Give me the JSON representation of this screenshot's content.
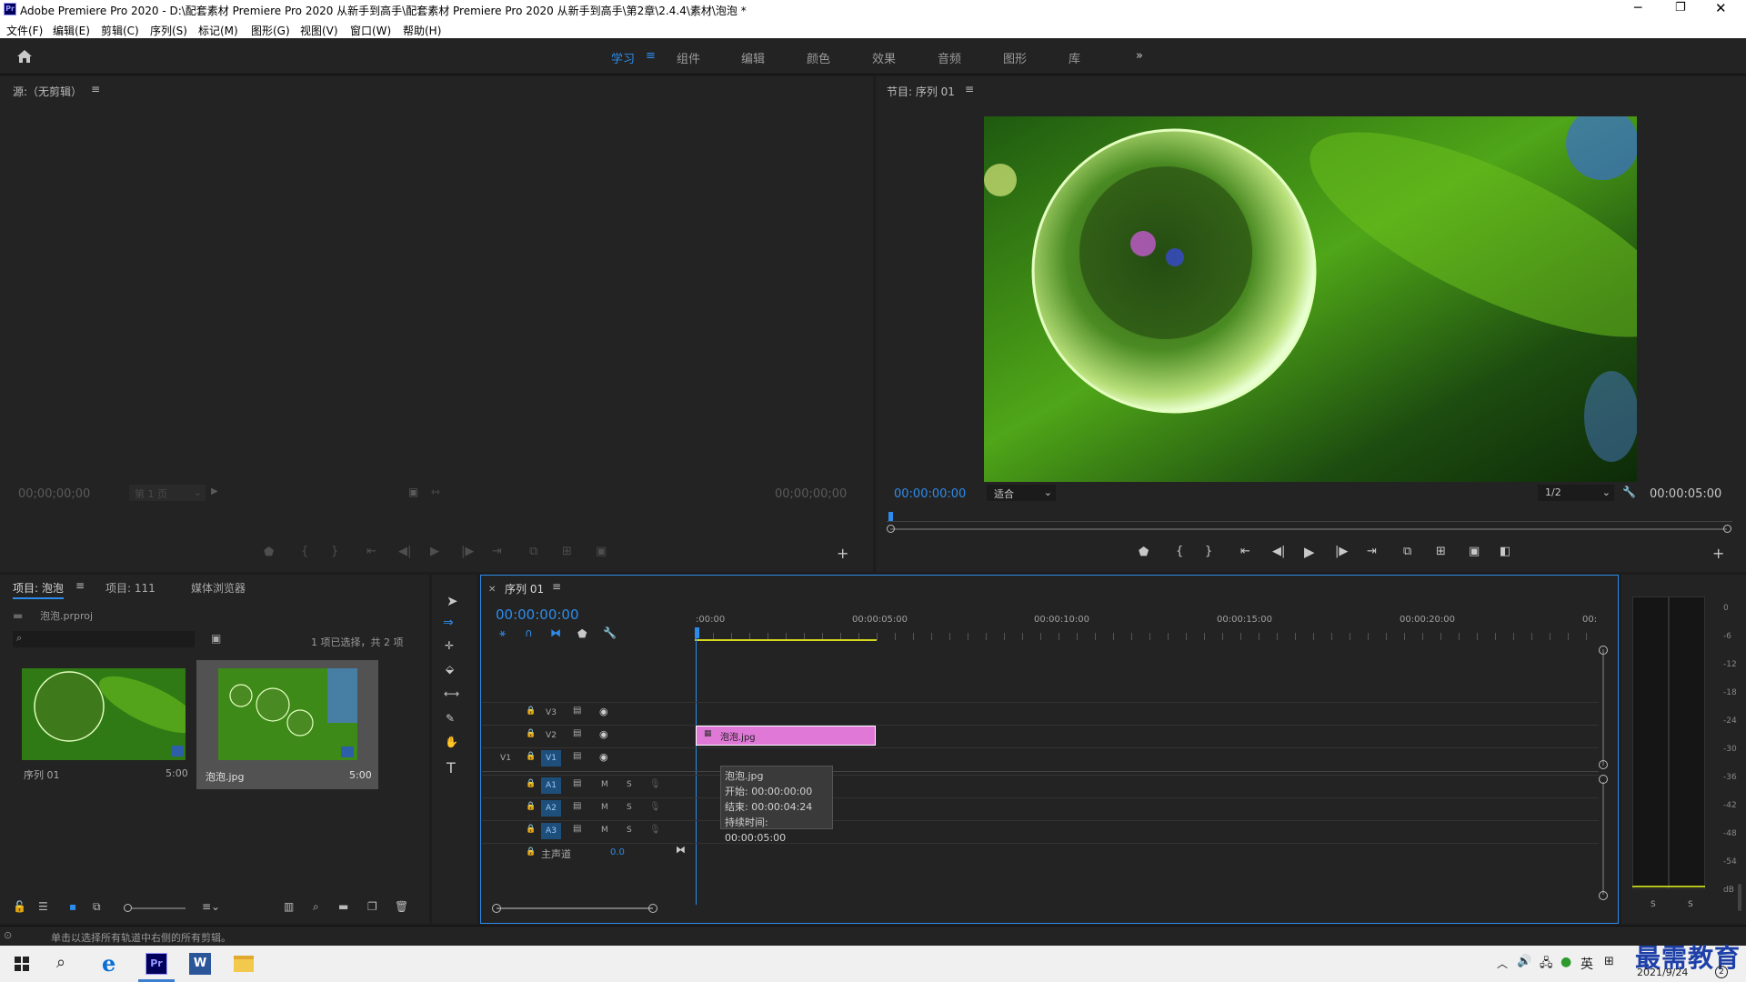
{
  "window": {
    "title": "Adobe Premiere Pro 2020 - D:\\配套素材 Premiere Pro 2020 从新手到高手\\配套素材 Premiere Pro 2020 从新手到高手\\第2章\\2.4.4\\素材\\泡泡 *",
    "app_badge": "Pr"
  },
  "menu": [
    "文件(F)",
    "编辑(E)",
    "剪辑(C)",
    "序列(S)",
    "标记(M)",
    "图形(G)",
    "视图(V)",
    "窗口(W)",
    "帮助(H)"
  ],
  "workspaces": [
    "学习",
    "组件",
    "编辑",
    "颜色",
    "效果",
    "音频",
    "图形",
    "库"
  ],
  "source_monitor": {
    "title": "源:（无剪辑）",
    "timecode_left": "00;00;00;00",
    "page": "第 1 页",
    "timecode_right": "00;00;00;00"
  },
  "program_monitor": {
    "title": "节目: 序列 01",
    "timecode": "00:00:00:00",
    "fit": "适合",
    "resolution": "1/2",
    "duration": "00:00:05:00"
  },
  "project_panel": {
    "tabs": [
      "项目: 泡泡",
      "项目: 111",
      "媒体浏览器"
    ],
    "file": "泡泡.prproj",
    "selection_info": "1 项已选择，共 2 项",
    "items": [
      {
        "name": "序列 01",
        "duration": "5:00"
      },
      {
        "name": "泡泡.jpg",
        "duration": "5:00"
      }
    ]
  },
  "timeline": {
    "tab": "序列 01",
    "timecode": "00:00:00:00",
    "ruler": [
      ":00:00",
      "00:00:05:00",
      "00:00:10:00",
      "00:00:15:00",
      "00:00:20:00",
      "00:"
    ],
    "video_tracks": [
      "V3",
      "V2",
      "V1"
    ],
    "source_patch": "V1",
    "audio_tracks": [
      "A1",
      "A2",
      "A3"
    ],
    "master_label": "主声道",
    "master_value": "0.0",
    "mute": "M",
    "solo": "S",
    "clip_name": "泡泡.jpg",
    "tooltip": {
      "name": "泡泡.jpg",
      "start": "开始: 00:00:00:00",
      "end": "结束: 00:00:04:24",
      "duration": "持续时间: 00:00:05:00"
    }
  },
  "audio_meter": {
    "scale": [
      "0",
      "-6",
      "-12",
      "-18",
      "-24",
      "-30",
      "-36",
      "-42",
      "-48",
      "-54",
      "dB"
    ],
    "solo_labels": [
      "S",
      "S"
    ]
  },
  "status_bar": "单击以选择所有轨道中右侧的所有剪辑。",
  "taskbar": {
    "time": "2021/9/24",
    "ime": "英",
    "watermark": "最需教育",
    "notification_count": "2"
  },
  "colors": {
    "accent_blue": "#2d8ceb",
    "clip_pink": "#e078d8",
    "panel_bg": "#232323"
  }
}
